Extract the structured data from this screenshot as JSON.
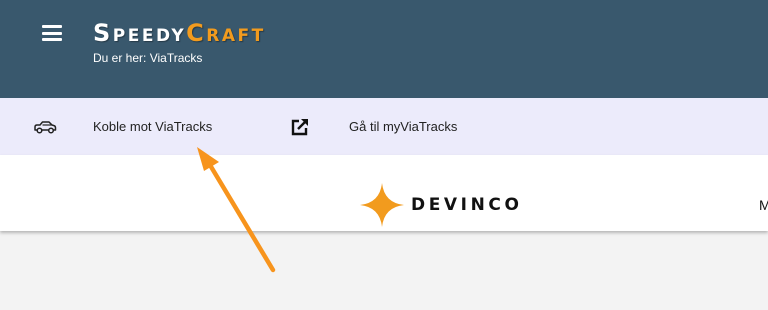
{
  "header": {
    "brand": {
      "s": "S",
      "peedy": "PEEDY",
      "c": "C",
      "raft": "RAFT"
    },
    "breadcrumb": "Du er her: ViaTracks",
    "menu_icon": "hamburger-icon"
  },
  "toolbar": {
    "connect": {
      "label": "Koble mot ViaTracks",
      "icon": "car-icon"
    },
    "goto": {
      "label": "Gå til myViaTracks",
      "icon": "external-link-icon"
    }
  },
  "brandbar": {
    "partner_logo": "DEVINCO",
    "truncated_text": "M"
  },
  "colors": {
    "header_bg": "#39586d",
    "toolbar_bg": "#ecebfb",
    "accent_orange": "#f29b1e",
    "page_bg": "#f3f3f3"
  },
  "annotation": {
    "type": "arrow",
    "color": "#f7941d"
  }
}
